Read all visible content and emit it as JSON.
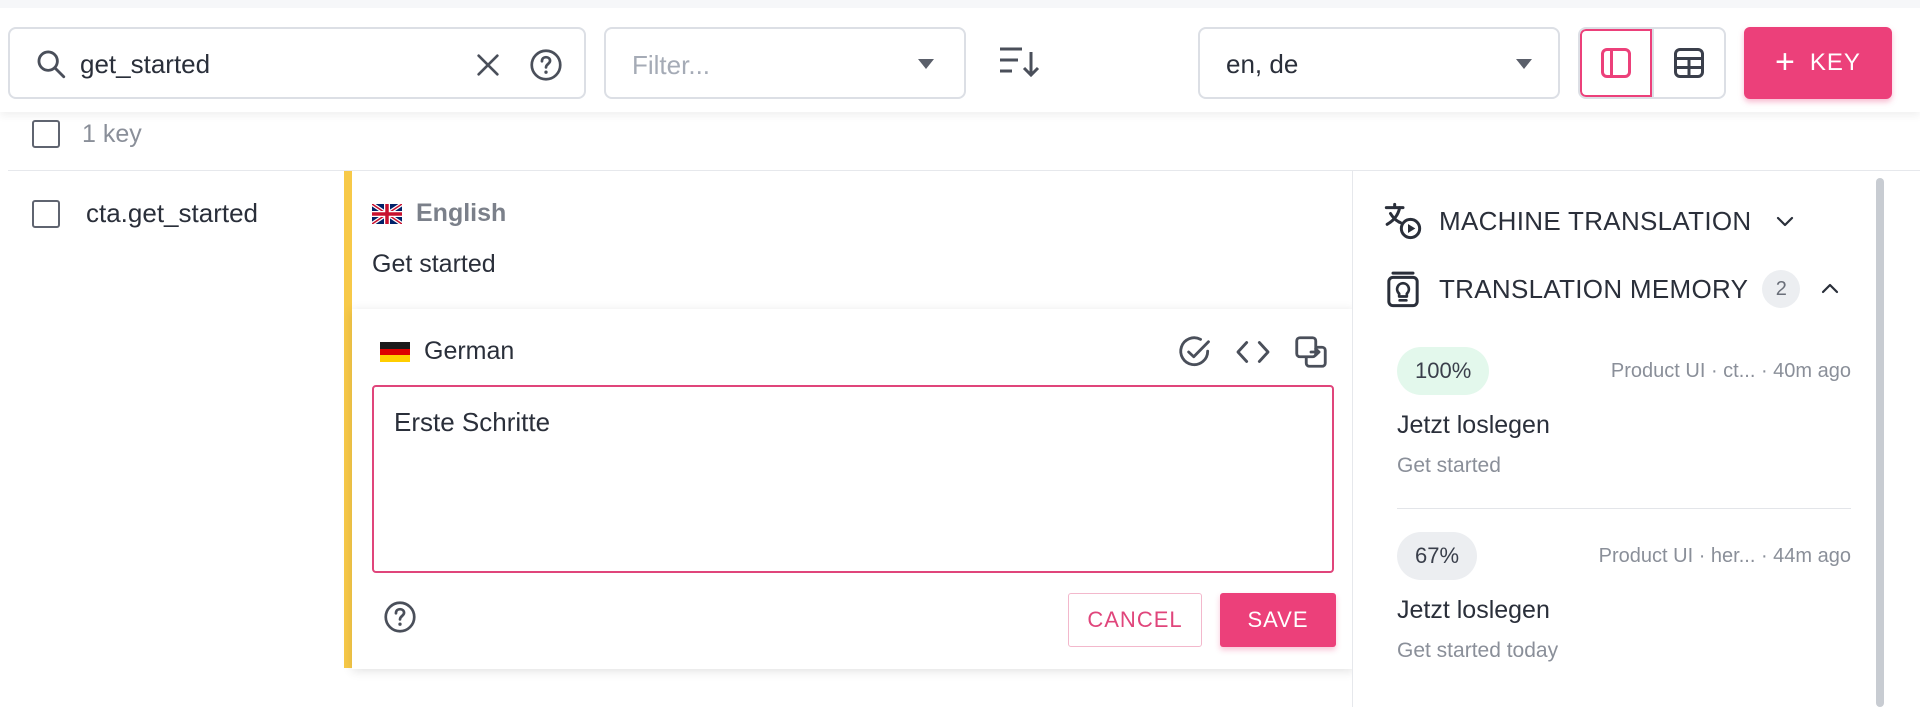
{
  "toolbar": {
    "search_value": "get_started",
    "filter_placeholder": "Filter...",
    "languages_value": "en, de",
    "add_key_label": "KEY"
  },
  "list": {
    "count_label": "1 key"
  },
  "key": {
    "name": "cta.get_started"
  },
  "english": {
    "language_name": "English",
    "text": "Get started"
  },
  "german": {
    "language_name": "German",
    "text": "Erste Schritte",
    "cancel_label": "CANCEL",
    "save_label": "SAVE"
  },
  "side_panel": {
    "machine_translation_title": "MACHINE TRANSLATION",
    "translation_memory_title": "TRANSLATION MEMORY",
    "translation_memory_count": "2",
    "memory_items": [
      {
        "match": "100%",
        "source": "Product UI · ct... · 40m ago",
        "target": "Jetzt loslegen",
        "original": "Get started"
      },
      {
        "match": "67%",
        "source": "Product UI · her... · 44m ago",
        "target": "Jetzt loslegen",
        "original": "Get started today"
      }
    ]
  },
  "colors": {
    "accent": "#ec407a",
    "edit_bar": "#f7c948",
    "match_high_bg": "#e3f8ec"
  }
}
